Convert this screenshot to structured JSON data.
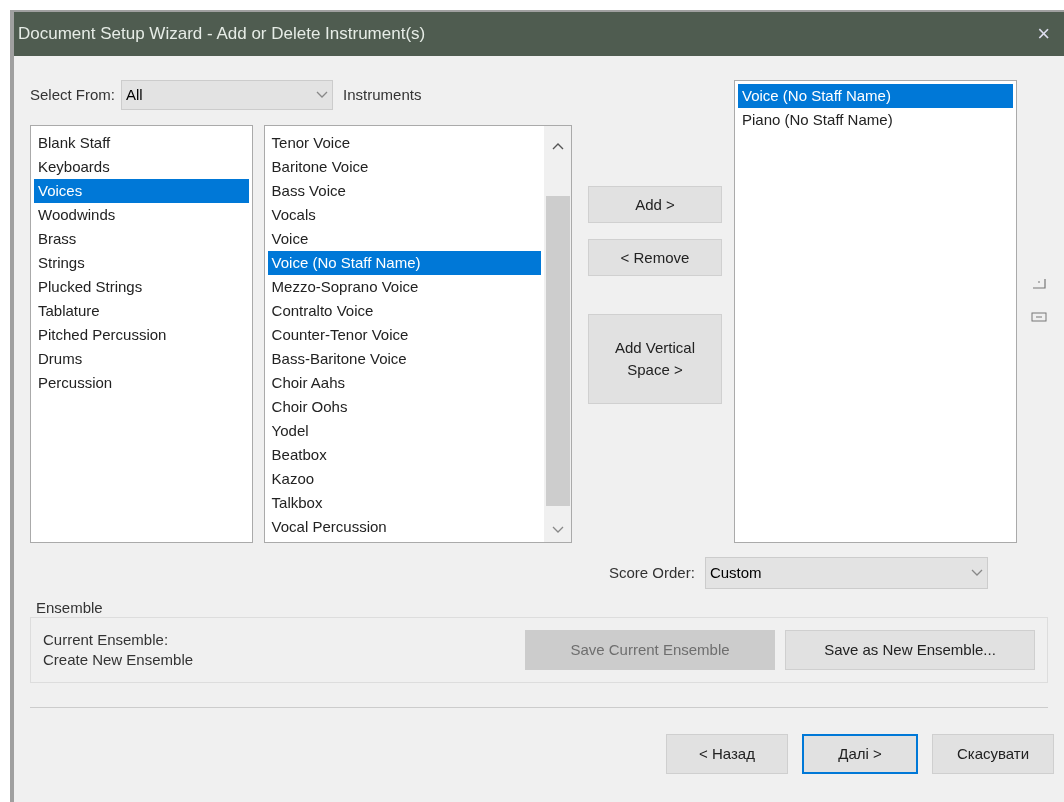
{
  "window": {
    "title": "Document Setup Wizard - Add or Delete Instrument(s)",
    "close": "×"
  },
  "select_from": {
    "label": "Select From:",
    "value": "All",
    "suffix": "Instruments"
  },
  "categories": [
    {
      "label": "Blank Staff",
      "selected": false
    },
    {
      "label": "Keyboards",
      "selected": false
    },
    {
      "label": "Voices",
      "selected": true
    },
    {
      "label": "Woodwinds",
      "selected": false
    },
    {
      "label": "Brass",
      "selected": false
    },
    {
      "label": "Strings",
      "selected": false
    },
    {
      "label": "Plucked Strings",
      "selected": false
    },
    {
      "label": "Tablature",
      "selected": false
    },
    {
      "label": "Pitched Percussion",
      "selected": false
    },
    {
      "label": "Drums",
      "selected": false
    },
    {
      "label": "Percussion",
      "selected": false
    }
  ],
  "instruments": [
    {
      "label": "Tenor Voice",
      "selected": false
    },
    {
      "label": "Baritone Voice",
      "selected": false
    },
    {
      "label": "Bass Voice",
      "selected": false
    },
    {
      "label": "Vocals",
      "selected": false
    },
    {
      "label": "Voice",
      "selected": false
    },
    {
      "label": "Voice (No Staff Name)",
      "selected": true
    },
    {
      "label": "Mezzo-Soprano Voice",
      "selected": false
    },
    {
      "label": "Contralto Voice",
      "selected": false
    },
    {
      "label": "Counter-Tenor Voice",
      "selected": false
    },
    {
      "label": "Bass-Baritone Voice",
      "selected": false
    },
    {
      "label": "Choir Aahs",
      "selected": false
    },
    {
      "label": "Choir Oohs",
      "selected": false
    },
    {
      "label": "Yodel",
      "selected": false
    },
    {
      "label": "Beatbox",
      "selected": false
    },
    {
      "label": "Kazoo",
      "selected": false
    },
    {
      "label": "Talkbox",
      "selected": false
    },
    {
      "label": "Vocal Percussion",
      "selected": false
    }
  ],
  "actions": [
    {
      "label": "Add >"
    },
    {
      "label": "< Remove"
    },
    {
      "label": "Add Vertical Space >"
    }
  ],
  "score": [
    {
      "label": "Voice (No Staff Name)",
      "selected": true
    },
    {
      "label": "Piano (No Staff Name)",
      "selected": false
    }
  ],
  "score_order": {
    "label": "Score Order:",
    "value": "Custom"
  },
  "ensemble": {
    "title": "Ensemble",
    "current_label": "Current Ensemble:",
    "current_value": "Create New Ensemble",
    "buttons": [
      {
        "label": "Save Current Ensemble",
        "disabled": true
      },
      {
        "label": "Save as New Ensemble...",
        "disabled": false
      }
    ]
  },
  "footer": [
    {
      "label": "< Назад",
      "focused": false
    },
    {
      "label": "Далі >",
      "focused": true
    },
    {
      "label": "Скасувати",
      "focused": false
    }
  ]
}
